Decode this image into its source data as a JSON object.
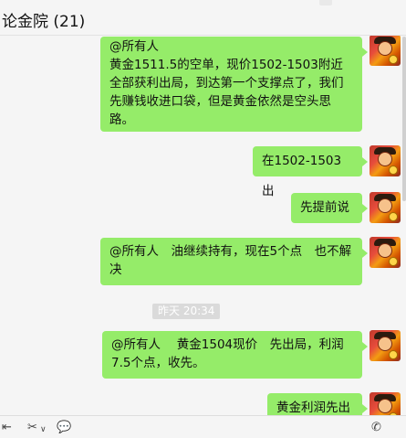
{
  "header": {
    "title": "论金院 (21)"
  },
  "messages": [
    {
      "text": "@所有人\n黄金1511.5的空单，现价1502-1503附近全部获利出局，到达第一个支撑点了，我们先赚钱收进口袋，但是黄金依然是空头思路。"
    },
    {
      "text": "在1502-1503出"
    },
    {
      "text": "先提前说"
    },
    {
      "text": "@所有人　油继续持有，现在5个点　也不解决"
    },
    {
      "text": "@所有人　 黄金1504现价　先出局，利润7.5个点，收先。"
    },
    {
      "text": "黄金利润先出"
    }
  ],
  "timestamp": "昨天 20:34",
  "toolbar": {
    "icons": [
      "share-icon",
      "scissors-icon",
      "chevron-down-icon",
      "chat-bubble-icon",
      "phone-icon"
    ]
  },
  "colors": {
    "bubble": "#95ec69",
    "background": "#f5f5f5"
  }
}
